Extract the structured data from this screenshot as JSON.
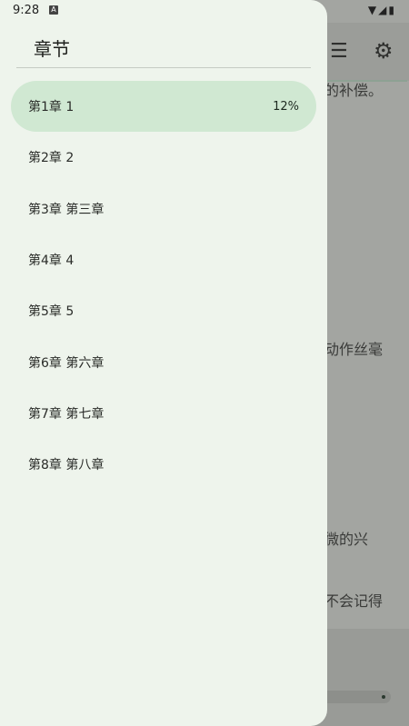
{
  "status_bar": {
    "time": "9:28",
    "notif_glyph": "A"
  },
  "drawer": {
    "title": "章节",
    "chapters": [
      {
        "label": "第1章 1",
        "progress": "12%"
      },
      {
        "label": "第2章 2"
      },
      {
        "label": "第3章 第三章"
      },
      {
        "label": "第4章 4"
      },
      {
        "label": "第5章 5"
      },
      {
        "label": "第6章 第六章"
      },
      {
        "label": "第7章 第七章"
      },
      {
        "label": "第8章 第八章"
      }
    ]
  },
  "background_reader": {
    "text_fragments": [
      "的补偿。",
      "动作丝毫",
      "微的兴",
      "不会记得"
    ]
  }
}
